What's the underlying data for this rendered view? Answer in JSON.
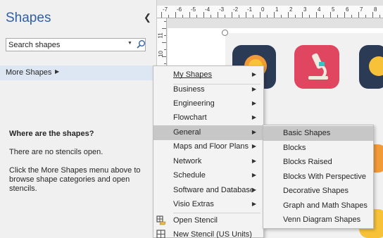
{
  "pane": {
    "title": "Shapes",
    "search_placeholder": "Search shapes",
    "more_shapes_label": "More Shapes",
    "info_title": "Where are the shapes?",
    "info_no_stencils": "There are no stencils open.",
    "info_hint": "Click the More Shapes menu above to browse shape categories and open stencils."
  },
  "ruler": {
    "horizontal_labels": [
      "-7",
      "-6",
      "-5",
      "-4",
      "-3",
      "-2",
      "-1",
      "0",
      "1",
      "2",
      "3",
      "4",
      "5",
      "6",
      "7",
      "8"
    ],
    "vertical_labels": [
      "11",
      "10"
    ]
  },
  "more_shapes_menu": {
    "items": [
      {
        "label": "My Shapes",
        "submenu": true
      },
      {
        "label": "Business",
        "submenu": true
      },
      {
        "label": "Engineering",
        "submenu": true
      },
      {
        "label": "Flowchart",
        "submenu": true
      },
      {
        "label": "General",
        "submenu": true,
        "highlighted": true
      },
      {
        "label": "Maps and Floor Plans",
        "submenu": true
      },
      {
        "label": "Network",
        "submenu": true
      },
      {
        "label": "Schedule",
        "submenu": true
      },
      {
        "label": "Software and Database",
        "submenu": true
      },
      {
        "label": "Visio Extras",
        "submenu": true
      },
      {
        "label": "Open Stencil",
        "icon": "open-stencil-icon"
      },
      {
        "label": "New Stencil (US Units)",
        "icon": "new-stencil-icon"
      }
    ]
  },
  "general_submenu": {
    "items": [
      {
        "label": "Basic Shapes",
        "highlighted": true
      },
      {
        "label": "Blocks"
      },
      {
        "label": "Blocks Raised"
      },
      {
        "label": "Blocks With Perspective"
      },
      {
        "label": "Decorative Shapes"
      },
      {
        "label": "Graph and Math Shapes"
      },
      {
        "label": "Venn Diagram Shapes"
      }
    ]
  },
  "colors": {
    "title_blue": "#2e5fa6",
    "more_shapes_bg": "#dde6f3",
    "menu_bg": "#f3f3f3",
    "menu_highlight": "#c7c7c7",
    "tile_navy": "#2b3a55",
    "tile_pink": "#e0465f",
    "tile_orange": "#f39a38",
    "tile_yellow": "#f8c238",
    "tile_purple": "#5a2746"
  }
}
